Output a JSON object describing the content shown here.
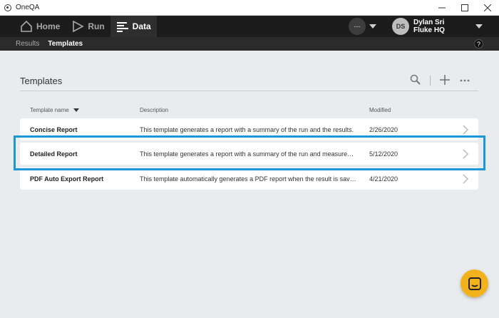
{
  "window": {
    "title": "OneQA"
  },
  "topnav": {
    "items": [
      {
        "label": "Home",
        "icon": "home-icon"
      },
      {
        "label": "Run",
        "icon": "play-icon"
      },
      {
        "label": "Data",
        "icon": "data-icon",
        "active": true
      }
    ],
    "status": "---",
    "user": {
      "initials": "DS",
      "name": "Dylan Sri",
      "org": "Fluke HQ"
    }
  },
  "subnav": {
    "items": [
      "Results",
      "Templates"
    ],
    "active": "Templates",
    "help": "?"
  },
  "page": {
    "title": "Templates"
  },
  "table": {
    "columns": [
      "Template name",
      "Description",
      "Modified"
    ],
    "sorted_column": "Template name",
    "rows": [
      {
        "name": "Concise Report",
        "description": "This template generates a report with a summary of the run and the results.",
        "modified": "2/26/2020"
      },
      {
        "name": "Detailed Report",
        "description": "This template generates a report with a summary of the run and measurements.",
        "modified": "5/12/2020"
      },
      {
        "name": "PDF Auto Export Report",
        "description": "This template automatically generates a PDF report when the result is saved.",
        "modified": "4/21/2020"
      }
    ],
    "highlighted_row": 1
  },
  "colors": {
    "accent": "#1b96d6",
    "fab": "#f3b21b",
    "nav_bg": "#1c1c1c"
  }
}
